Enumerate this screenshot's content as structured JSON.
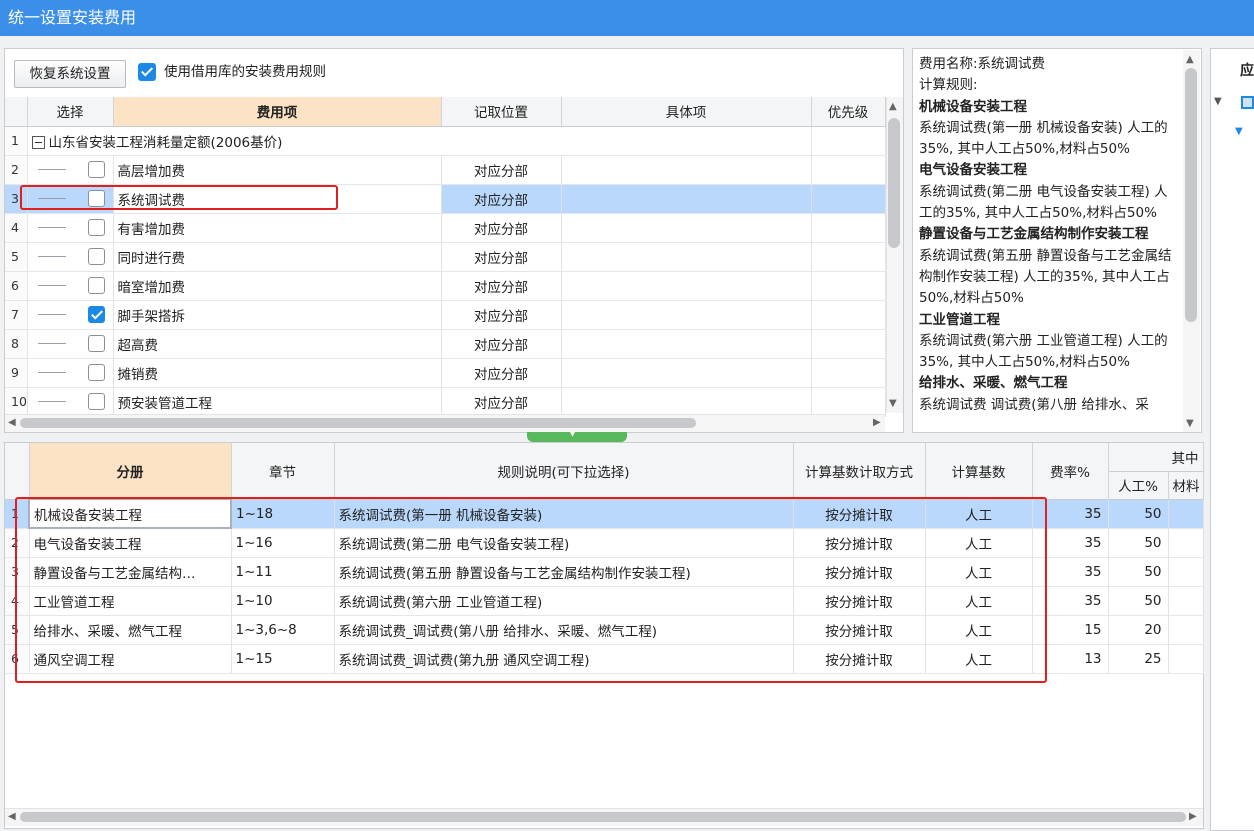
{
  "window": {
    "title": "统一设置安装费用"
  },
  "toolbar": {
    "restore_label": "恢复系统设置",
    "use_rules_label": "使用借用库的安装费用规则",
    "use_rules_checked": true
  },
  "fee_table": {
    "headers": [
      "选择",
      "费用项",
      "记取位置",
      "具体项",
      "优先级"
    ],
    "group_row": {
      "num": "1",
      "label": "山东省安装工程消耗量定额(2006基价)"
    },
    "rows": [
      {
        "num": "2",
        "checked": false,
        "name": "高层增加费",
        "position": "对应分部"
      },
      {
        "num": "3",
        "checked": false,
        "name": "系统调试费",
        "position": "对应分部"
      },
      {
        "num": "4",
        "checked": false,
        "name": "有害增加费",
        "position": "对应分部"
      },
      {
        "num": "5",
        "checked": false,
        "name": "同时进行费",
        "position": "对应分部"
      },
      {
        "num": "6",
        "checked": false,
        "name": "暗室增加费",
        "position": "对应分部"
      },
      {
        "num": "7",
        "checked": true,
        "name": "脚手架搭拆",
        "position": "对应分部"
      },
      {
        "num": "8",
        "checked": false,
        "name": "超高费",
        "position": "对应分部"
      },
      {
        "num": "9",
        "checked": false,
        "name": "摊销费",
        "position": "对应分部"
      },
      {
        "num": "10",
        "checked": false,
        "name": "预安装管道工程",
        "position": "对应分部"
      }
    ]
  },
  "description": {
    "fee_name": "费用名称:系统调试费",
    "rule_label": "计算规则:",
    "sections": [
      {
        "title": "机械设备安装工程",
        "text": "系统调试费(第一册 机械设备安装) 人工的35%, 其中人工占50%,材料占50%"
      },
      {
        "title": "电气设备安装工程",
        "text": "系统调试费(第二册 电气设备安装工程) 人工的35%, 其中人工占50%,材料占50%"
      },
      {
        "title": "静置设备与工艺金属结构制作安装工程",
        "text": "系统调试费(第五册 静置设备与工艺金属结构制作安装工程) 人工的35%, 其中人工占50%,材料占50%"
      },
      {
        "title": "工业管道工程",
        "text": "系统调试费(第六册 工业管道工程) 人工的35%, 其中人工占50%,材料占50%"
      },
      {
        "title": "给排水、采暖、燃气工程",
        "text": "系统调试费 调试费(第八册 给排水、采"
      }
    ]
  },
  "right_panel": {
    "header": "应"
  },
  "rule_table": {
    "headers": {
      "volume": "分册",
      "chapter": "章节",
      "rule": "规则说明(可下拉选择)",
      "calc_method": "计算基数计取方式",
      "calc_base": "计算基数",
      "rate": "费率%",
      "group": "其中",
      "labor": "人工%",
      "material": "材料"
    },
    "rows": [
      {
        "num": "1",
        "volume": "机械设备安装工程",
        "chapter": "1~18",
        "rule": "系统调试费(第一册 机械设备安装)",
        "method": "按分摊计取",
        "base": "人工",
        "rate": "35",
        "labor": "50"
      },
      {
        "num": "2",
        "volume": "电气设备安装工程",
        "chapter": "1~16",
        "rule": "系统调试费(第二册 电气设备安装工程)",
        "method": "按分摊计取",
        "base": "人工",
        "rate": "35",
        "labor": "50"
      },
      {
        "num": "3",
        "volume": "静置设备与工艺金属结构…",
        "chapter": "1~11",
        "rule": "系统调试费(第五册 静置设备与工艺金属结构制作安装工程)",
        "method": "按分摊计取",
        "base": "人工",
        "rate": "35",
        "labor": "50"
      },
      {
        "num": "4",
        "volume": "工业管道工程",
        "chapter": "1~10",
        "rule": "系统调试费(第六册 工业管道工程)",
        "method": "按分摊计取",
        "base": "人工",
        "rate": "35",
        "labor": "50"
      },
      {
        "num": "5",
        "volume": "给排水、采暖、燃气工程",
        "chapter": "1~3,6~8",
        "rule": "系统调试费_调试费(第八册 给排水、采暖、燃气工程)",
        "method": "按分摊计取",
        "base": "人工",
        "rate": "15",
        "labor": "20"
      },
      {
        "num": "6",
        "volume": "通风空调工程",
        "chapter": "1~15",
        "rule": "系统调试费_调试费(第九册 通风空调工程)",
        "method": "按分摊计取",
        "base": "人工",
        "rate": "13",
        "labor": "25"
      }
    ]
  },
  "colors": {
    "titlebar": "#3b8fe8",
    "selection": "#b9d8fb",
    "highlight": "#e02020",
    "checkbox": "#1e88e5"
  },
  "icons": [
    "checkbox-icon",
    "collapse-minus-icon",
    "scroll-up-icon",
    "scroll-down-icon",
    "scroll-left-icon",
    "scroll-right-icon",
    "splitter-grip-icon",
    "tree-expand-icon"
  ]
}
